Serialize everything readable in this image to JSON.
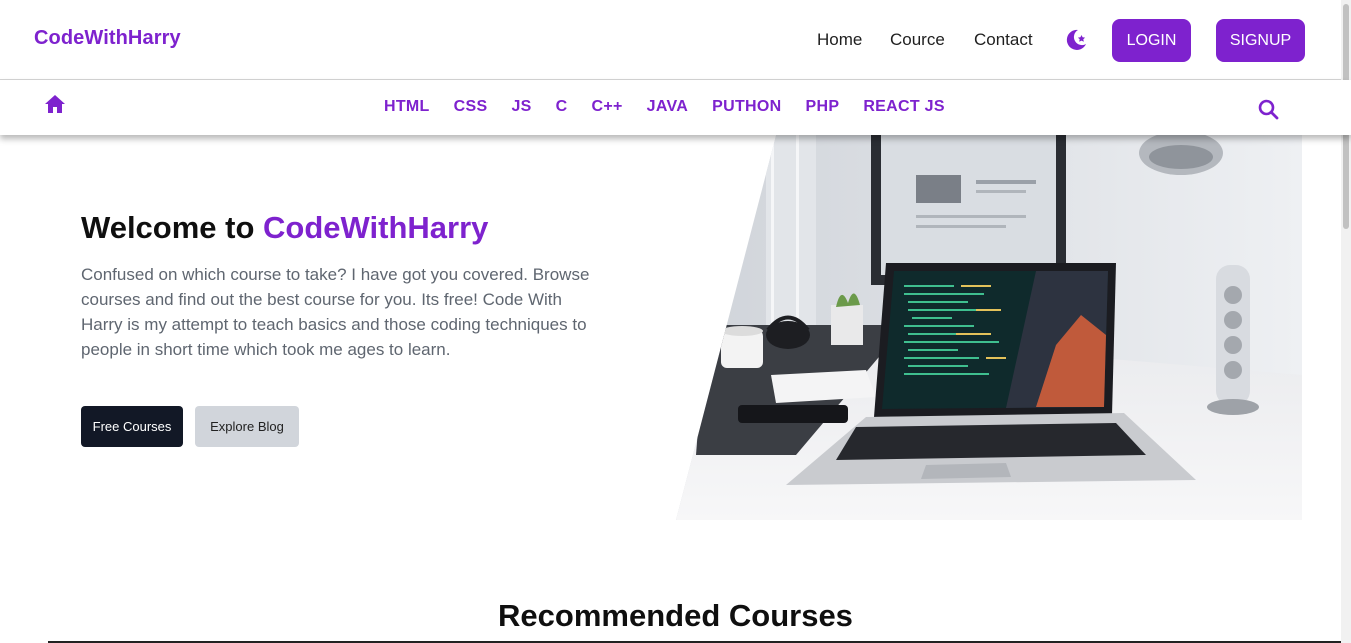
{
  "header": {
    "brand": "CodeWithHarry",
    "nav": {
      "home": "Home",
      "cource": "Cource",
      "contact": "Contact"
    },
    "login_label": "LOGIN",
    "signup_label": "SIGNUP",
    "theme_icon": "moon-star-icon"
  },
  "subnav": {
    "home_icon": "home-icon",
    "languages": [
      "HTML",
      "CSS",
      "JS",
      "C",
      "C++",
      "JAVA",
      "PUTHON",
      "PHP",
      "REACT JS"
    ],
    "search_icon": "search-icon"
  },
  "hero": {
    "title_prefix": "Welcome to ",
    "title_accent": "CodeWithHarry",
    "description": "Confused on which course to take? I have got you covered. Browse courses and find out the best course for you. Its free! Code With Harry is my attempt to teach basics and those coding techniques to people in short time which took me ages to learn.",
    "primary_button": "Free Courses",
    "secondary_button": "Explore Blog"
  },
  "recommended": {
    "title": "Recommended Courses"
  },
  "colors": {
    "accent": "#7e22ce",
    "dark_button": "#121826",
    "light_button": "#d1d5db",
    "text_muted": "#5f6670"
  }
}
